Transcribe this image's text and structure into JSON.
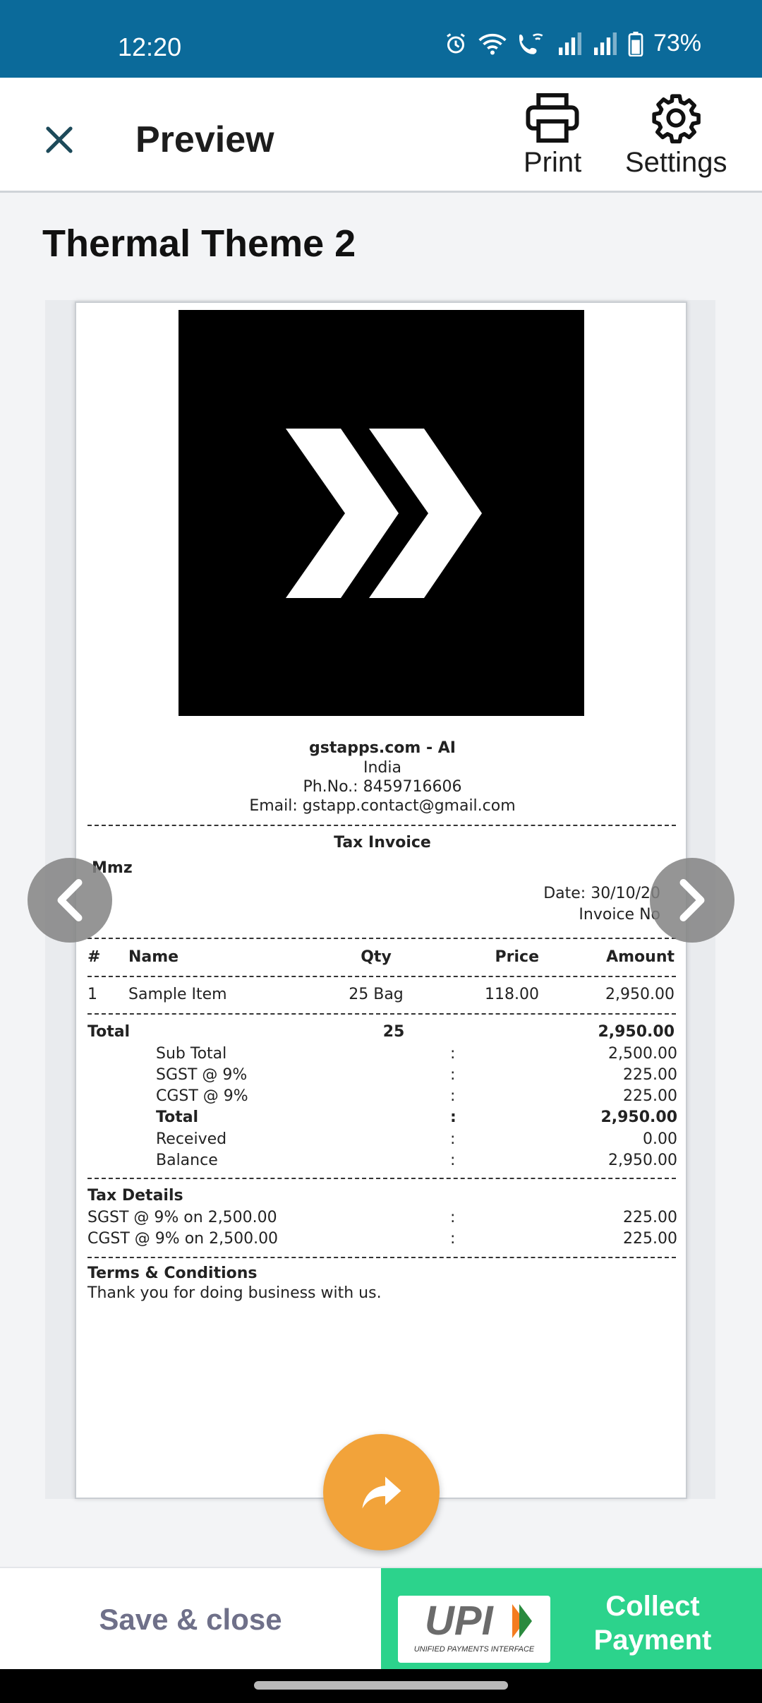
{
  "status_bar": {
    "time": "12:20",
    "battery": "73%",
    "icons": [
      "alarm-icon",
      "wifi-icon",
      "wifi-calling-icon",
      "signal-icon",
      "signal-icon",
      "battery-icon"
    ]
  },
  "app_bar": {
    "title": "Preview",
    "close_icon": "close-icon",
    "actions": [
      {
        "label": "Print",
        "icon": "printer-icon"
      },
      {
        "label": "Settings",
        "icon": "gear-icon"
      }
    ]
  },
  "theme_title": "Thermal Theme 2",
  "invoice": {
    "business": {
      "name": "gstapps.com - AI",
      "country": "India",
      "phone": "Ph.No.: 8459716606",
      "email": "Email: gstapp.contact@gmail.com"
    },
    "title": "Tax Invoice",
    "party": "Mmz",
    "date": "Date: 30/10/20",
    "invoice_no": "Invoice No",
    "columns": [
      "#",
      "Name",
      "Qty",
      "Price",
      "Amount"
    ],
    "items": [
      {
        "num": "1",
        "name": "Sample Item",
        "qty": "25 Bag",
        "price": "118.00",
        "amount": "2,950.00"
      }
    ],
    "total_row": {
      "label": "Total",
      "qty": "25",
      "amount": "2,950.00"
    },
    "summary": [
      {
        "label": "Sub Total",
        "colon": ":",
        "value": "2,500.00"
      },
      {
        "label": "SGST @ 9%",
        "colon": ":",
        "value": "225.00"
      },
      {
        "label": "CGST @ 9%",
        "colon": ":",
        "value": "225.00"
      },
      {
        "label": "Total",
        "colon": ":",
        "value": "2,950.00"
      },
      {
        "label": "Received",
        "colon": ":",
        "value": "0.00"
      },
      {
        "label": "Balance",
        "colon": ":",
        "value": "2,950.00"
      }
    ],
    "tax_details": {
      "heading": "Tax Details",
      "rows": [
        {
          "label": "SGST @ 9% on 2,500.00",
          "colon": ":",
          "value": "225.00"
        },
        {
          "label": "CGST @ 9% on 2,500.00",
          "colon": ":",
          "value": "225.00"
        }
      ]
    },
    "terms": {
      "heading": "Terms & Conditions",
      "text": "Thank you for doing business with us."
    }
  },
  "bottom_bar": {
    "save_close": "Save & close",
    "upi_logo_text": "UPI",
    "upi_caption": "UNIFIED PAYMENTS INTERFACE",
    "collect_line1": "Collect",
    "collect_line2": "Payment"
  },
  "colors": {
    "status_bar": "#0b6a9a",
    "fab": "#f2a33a",
    "collect": "#2cd38c",
    "save_text": "#6f7089"
  }
}
